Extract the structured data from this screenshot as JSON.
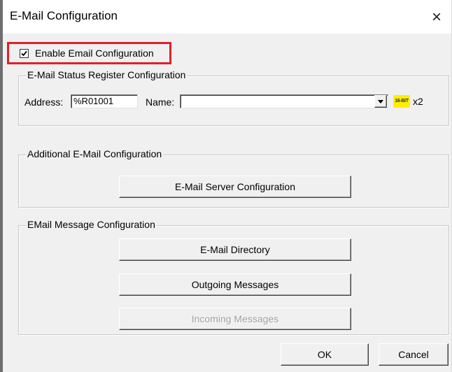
{
  "window": {
    "title": "E-Mail Configuration",
    "close_glyph": "×"
  },
  "enable": {
    "label": "Enable Email Configuration",
    "checked": true
  },
  "status_register": {
    "group_label": "E-Mail Status Register Configuration",
    "address_label": "Address:",
    "address_value": "%R01001",
    "name_label": "Name:",
    "name_value": "",
    "bit_badge": "16-BIT",
    "multiplier": "x2"
  },
  "additional": {
    "group_label": "Additional E-Mail Configuration",
    "server_button": "E-Mail Server Configuration"
  },
  "message": {
    "group_label": "EMail Message Configuration",
    "directory_button": "E-Mail Directory",
    "outgoing_button": "Outgoing Messages",
    "incoming_button": "Incoming Messages"
  },
  "footer": {
    "ok_button": "OK",
    "cancel_button": "Cancel"
  },
  "colors": {
    "highlight_border": "#e0202a",
    "dialog_bg": "#f0f0f0",
    "badge_bg": "#ffee00"
  }
}
